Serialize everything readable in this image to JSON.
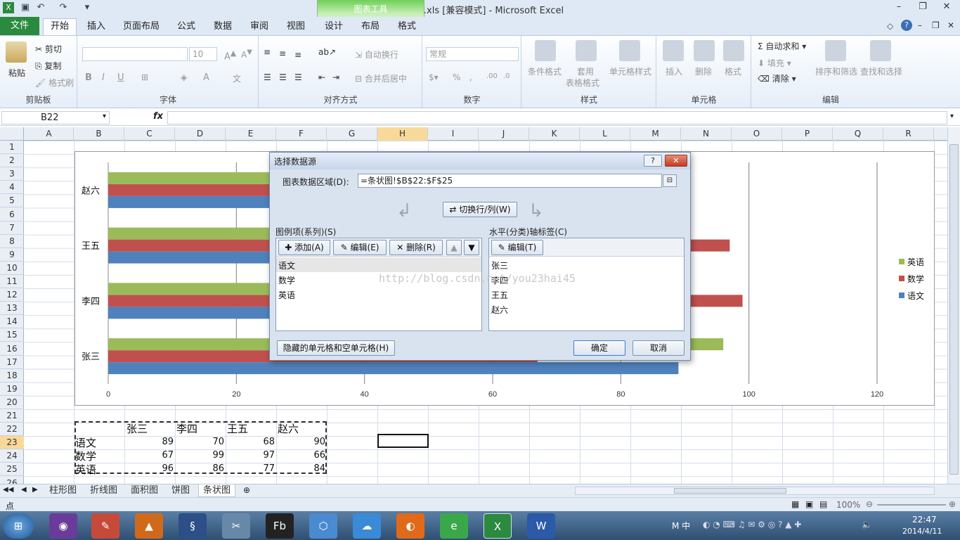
{
  "window": {
    "title": "柱形图.xls  [兼容模式] - Microsoft Excel",
    "context_group": "图表工具"
  },
  "tabs": {
    "file": "文件",
    "home": "开始",
    "items": [
      "插入",
      "页面布局",
      "公式",
      "数据",
      "审阅",
      "视图",
      "设计",
      "布局",
      "格式"
    ]
  },
  "ribbon": {
    "clipboard": {
      "label": "剪贴板",
      "paste": "粘贴",
      "cut": "剪切",
      "copy": "复制",
      "format_painter": "格式刷"
    },
    "font": {
      "label": "字体",
      "size": "10"
    },
    "alignment": {
      "label": "对齐方式",
      "wrap": "自动换行",
      "merge": "合并后居中"
    },
    "number": {
      "label": "数字",
      "format": "常规"
    },
    "styles": {
      "label": "样式",
      "cond": "条件格式",
      "table": "套用",
      "table2": "表格格式",
      "cell": "单元格样式"
    },
    "cells": {
      "label": "单元格",
      "insert": "插入",
      "delete": "删除",
      "format": "格式"
    },
    "editing": {
      "label": "编辑",
      "autosum": "自动求和",
      "fill": "填充",
      "clear": "清除",
      "sort": "排序和筛选",
      "find": "查找和选择"
    }
  },
  "formula_bar": {
    "name_box": "B22",
    "fx": "fx",
    "formula": ""
  },
  "columns": [
    "A",
    "B",
    "C",
    "D",
    "E",
    "F",
    "G",
    "H",
    "I",
    "J",
    "K",
    "L",
    "M",
    "N",
    "O",
    "P",
    "Q",
    "R"
  ],
  "rows": [
    "1",
    "2",
    "3",
    "4",
    "5",
    "6",
    "7",
    "8",
    "9",
    "10",
    "11",
    "12",
    "13",
    "14",
    "15",
    "16",
    "17",
    "18",
    "19",
    "20",
    "21",
    "22",
    "23",
    "24",
    "25",
    "26"
  ],
  "table": {
    "header": [
      "张三",
      "李四",
      "王五",
      "赵六"
    ],
    "rows": [
      {
        "label": "语文",
        "values": [
          "89",
          "70",
          "68",
          "90"
        ]
      },
      {
        "label": "数学",
        "values": [
          "67",
          "99",
          "97",
          "66"
        ]
      },
      {
        "label": "英语",
        "values": [
          "96",
          "86",
          "77",
          "84"
        ]
      }
    ]
  },
  "chart_data": {
    "type": "bar",
    "orientation": "horizontal",
    "categories": [
      "张三",
      "李四",
      "王五",
      "赵六"
    ],
    "series": [
      {
        "name": "语文",
        "color": "#4f81bd",
        "values": [
          89,
          70,
          68,
          90
        ]
      },
      {
        "name": "数学",
        "color": "#c0504d",
        "values": [
          67,
          99,
          97,
          66
        ]
      },
      {
        "name": "英语",
        "color": "#9bbb59",
        "values": [
          96,
          86,
          77,
          84
        ]
      }
    ],
    "xlim": [
      0,
      120
    ],
    "xticks": [
      "0",
      "20",
      "40",
      "60",
      "80",
      "100",
      "120"
    ],
    "legend": "right",
    "grid": true
  },
  "dialog": {
    "title": "选择数据源",
    "range_label": "图表数据区域(D):",
    "range_value": "=条状图!$B$22:$F$25",
    "switch": "切换行/列(W)",
    "legend_label": "图例项(系列)(S)",
    "add": "添加(A)",
    "edit": "编辑(E)",
    "delete": "删除(R)",
    "series": [
      "语文",
      "数学",
      "英语"
    ],
    "axis_label": "水平(分类)轴标签(C)",
    "axis_edit": "编辑(T)",
    "categories": [
      "张三",
      "李四",
      "王五",
      "赵六"
    ],
    "hidden_btn": "隐藏的单元格和空单元格(H)",
    "ok": "确定",
    "cancel": "取消",
    "watermark": "http://blog.csdn.net/you23hai45"
  },
  "sheets": [
    "柱形图",
    "折线图",
    "面积图",
    "饼图",
    "条状图"
  ],
  "status": {
    "mode": "点",
    "zoom": "100%"
  },
  "taskbar": {
    "time": "22:47",
    "date": "2014/4/11",
    "tray_ime": "中"
  }
}
